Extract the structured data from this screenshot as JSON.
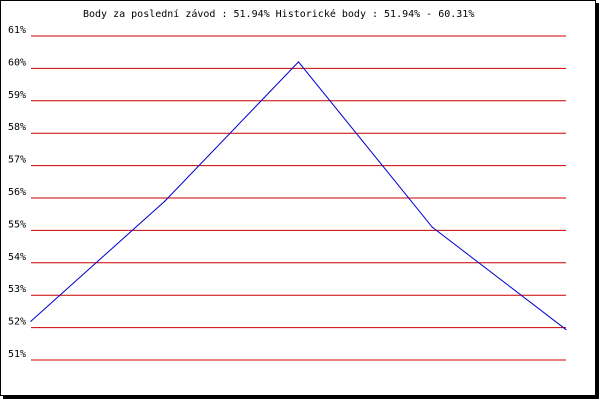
{
  "chart_data": {
    "type": "line",
    "title": "Body za poslední závod : 51.94%  Historické body : 51.94% - 60.31%",
    "xlabel": "",
    "ylabel": "",
    "ylim": [
      51,
      61
    ],
    "yticks": [
      "61%",
      "60%",
      "59%",
      "58%",
      "57%",
      "56%",
      "55%",
      "54%",
      "53%",
      "52%",
      "51%"
    ],
    "grid": true,
    "series": [
      {
        "values": [
          52.2,
          55.9,
          60.2,
          55.1,
          51.94
        ]
      }
    ]
  },
  "colors": {
    "gridline": "#cc0000",
    "line": "#0000cc",
    "frame": "#000000",
    "background": "#ffffff"
  }
}
